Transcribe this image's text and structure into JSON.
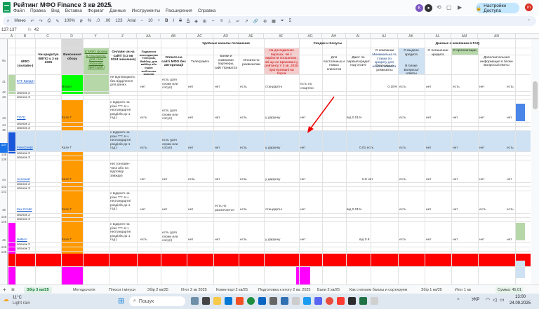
{
  "app": {
    "title": "Рейтинг МФО Finance 3 кв 2025",
    "menu": [
      "Файл",
      "Правка",
      "Вид",
      "Вставка",
      "Формат",
      "Данные",
      "Инструменты",
      "Расширения",
      "Справка"
    ],
    "share": "Настройки Доступа"
  },
  "toolbar": {
    "search": "Меню",
    "zoom": "100%",
    "font": "Arial",
    "size": "10",
    "items": [
      "₽",
      "%",
      ".0",
      ".00",
      "123"
    ]
  },
  "formula": {
    "cellref": "137:137",
    "fx": "fx",
    "value": "42"
  },
  "cols": [
    "A",
    "B",
    "C",
    "D",
    "Y",
    "Z",
    "AA",
    "AB",
    "AC",
    "AD",
    "AE",
    "AF",
    "AG",
    "AH",
    "AI",
    "AJ",
    "AK",
    "AL",
    "AM",
    "AN"
  ],
  "headers": {
    "no": "№",
    "mfo": "МФО (онлайн-)",
    "credit": "Чи кредитує ВВПО у 3 кв 2025",
    "status": "Виконання обору",
    "forms": "Є МФО форми в Альпуаллу, для і або першому, приглядів і",
    "online": "Онлайн чи на сайті (з 2 кв 2024 значення)",
    "submit": "Подання в месенджерах Телеграм, Вайбер, для вайбер або інших мобільних каналів",
    "pay": "Оплата на сайті МФО без авторизації",
    "channels": "Удобные каналы погашения",
    "tg": "Телеграм/іч",
    "bank": "Банки и компании партнеры, сайт Приват24",
    "req": "Оплата по реквизитам",
    "ruling": "На досліджених виразах, які є варіанти погашених, які що не враховані у рейтингу У 3 кв. 2025 прогнозовані на борги",
    "promo": "Скидки и бонусы",
    "reg": "Для постоянных и новых клиентов",
    "first": "Дают по первый кредит под 0,01%",
    "min": "Минимальна % ставка по кредиту для нового клиента",
    "faq": "Данные о компании в FAQ",
    "about": "О компании",
    "issue": "О выдаче кредита",
    "repay": "О погашении кредита",
    "ext": "О пролонгации",
    "extra": "Дополнительная информация в блоке Вопросы/ответы",
    "req2": "Платежные реквизиты",
    "inblock": "В блоке Вопросы/ответы"
  },
  "rows": [
    {
      "n": "41",
      "name": "КТГ Кредит",
      "status": "Впоря",
      "online": "не відповідають без відділення для даних",
      "yes": "нет",
      "pay": "есть (для серии или сосуп)",
      "a": "нет",
      "b": "нет",
      "c": "есть",
      "std": "стандартні",
      "first": "есть но спартіно",
      "rate": "0.15%",
      "f1": "есть",
      "f2": "нет",
      "f3": "есть",
      "f4": "нет",
      "f5": "есть"
    },
    {
      "n": "42",
      "name": "звонок 2"
    },
    {
      "n": "43",
      "name": "звонок 3"
    },
    {
      "n": "43",
      "name": "ТОП1",
      "status": "Кате Г",
      "online": "є відкриті на різні ТТ: в ч. неотандартні розділів до 1 год.)",
      "yes": "есть",
      "pay": "есть (для серии или сосуп)",
      "a": "нет",
      "b": "нет",
      "c": "есть",
      "std": "у дарунку",
      "first": "нет",
      "rate": "від 0.01%",
      "f1": "есть",
      "f2": "нет",
      "f3": "нет",
      "f4": "нет",
      "f5": "нет"
    },
    {
      "n": "44",
      "name": "звонок 2"
    },
    {
      "n": "45",
      "name": "звонок 3"
    },
    {
      "n": "137",
      "name": "FreeCredit",
      "status": "Кате Г",
      "online": "є відкриті на різні ТТ: в ч. неотандартні розділів до 1 год.)",
      "yes": "есть",
      "pay": "есть (для серии или сосуп)",
      "a": "нет",
      "b": "нет",
      "c": "есть",
      "std": "у дарунку",
      "first": "нет",
      "rate": "0.01 есть",
      "f1": "есть",
      "f2": "нет",
      "f3": "нет",
      "f4": "нет",
      "f5": "есть"
    },
    {
      "n": "138",
      "name": "звонок 2"
    },
    {
      "n": "139",
      "name": "звонок 3"
    },
    {
      "n": "44",
      "name": "Ассоней",
      "status": "Кате Г",
      "online": "нет (онлайн-чата або на відповіді завжди)",
      "yes": "нет",
      "pay": "нет",
      "a": "есть",
      "b": "нет",
      "c": "есть",
      "std": "у дарунку",
      "first": "нет",
      "rate": "0.8 нет",
      "f1": "есть",
      "f2": "нет",
      "f3": "нет",
      "f4": "нет",
      "f5": "нет"
    },
    {
      "n": "142",
      "name": "звонок 2"
    },
    {
      "n": "143",
      "name": "звонок 3"
    },
    {
      "n": "45",
      "name": "Кек Credit",
      "status": "Кате Г",
      "online": "є відкриті на різні ТТ: в ч. неотандартні розділів до 1 год.)",
      "yes": "нет",
      "pay": "нет",
      "a": "нет",
      "b": "есть но различается",
      "c": "есть",
      "std": "стандартні",
      "first": "нет",
      "rate": "від 0.01%",
      "f1": "есть",
      "f2": "нет",
      "f3": "нет",
      "f4": "есть",
      "f5": "есть"
    },
    {
      "n": "145",
      "name": "звонок 2"
    },
    {
      "n": "146",
      "name": "звонок 3"
    },
    {
      "n": "46",
      "name": "НеВол",
      "status": "Кате Г",
      "online": "є відкриті на різні ТТ: в ч. неотандартні розділів до 1 год.)",
      "yes": "есть",
      "pay": "есть (для серии или сосуп)",
      "a": "нет",
      "b": "нет",
      "c": "есть",
      "std": "у дарунку",
      "first": "нет",
      "rate": "від 0.9",
      "f1": "есть",
      "f2": "нет",
      "f3": "нет",
      "f4": "нет",
      "f5": "нет"
    },
    {
      "n": "148",
      "name": "звонок 2"
    },
    {
      "n": "149",
      "name": "звонок 3"
    }
  ],
  "sheets": [
    "Збір 3 кв/25",
    "Методологія",
    "Плюси і мінуси",
    "Збір 2 кв/25",
    "Итог 2 кв 2025",
    "Коментарі 2 кв/25",
    "Подготовка к итогу 2 кв. 2025",
    "Бали 2 кв/25",
    "Как считаем баллы и сортируем",
    "Збір 1 кв/25",
    "Итог 1 кв"
  ],
  "sum": "Сумма: 45,01",
  "taskbar": {
    "weather": "11°C",
    "weather2": "Light rain",
    "search": "Пошук",
    "lang": "УКР",
    "time": "13:00",
    "date": "24.09.2025"
  },
  "colors": {
    "green": "#00ff00",
    "orange": "#ff9900",
    "magenta": "#ff00ff",
    "red": "#ff0000",
    "lightblue": "#cfe2f3",
    "pink": "#f4cccc",
    "mint": "#b6d7a8"
  }
}
